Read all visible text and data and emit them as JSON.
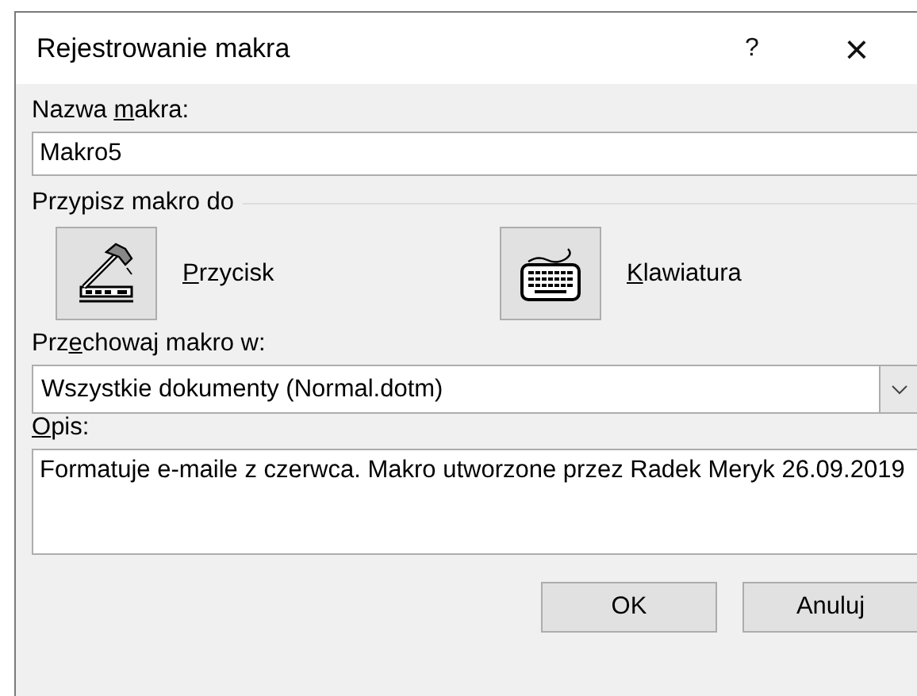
{
  "window": {
    "title": "Rejestrowanie makra",
    "help_glyph": "?",
    "close_glyph": "×"
  },
  "macro_name": {
    "label": {
      "before": "Nazwa ",
      "key": "m",
      "after": "akra:"
    },
    "value": "Makro5"
  },
  "assign": {
    "title": "Przypisz makro do",
    "options": [
      {
        "kind": "button",
        "label": {
          "key": "P",
          "after": "rzycisk"
        }
      },
      {
        "kind": "keyboard",
        "label": {
          "key": "K",
          "after": "lawiatura"
        }
      }
    ]
  },
  "store_in": {
    "label": {
      "before": "Prz",
      "key": "e",
      "after": "chowaj makro w:"
    },
    "value": "Wszystkie dokumenty (Normal.dotm)"
  },
  "description": {
    "label": {
      "key": "O",
      "after": "pis:"
    },
    "value": "Formatuje e-maile z czerwca. Makro utworzone przez Radek Meryk 26.09.2019"
  },
  "buttons": [
    "OK",
    "Anuluj"
  ]
}
